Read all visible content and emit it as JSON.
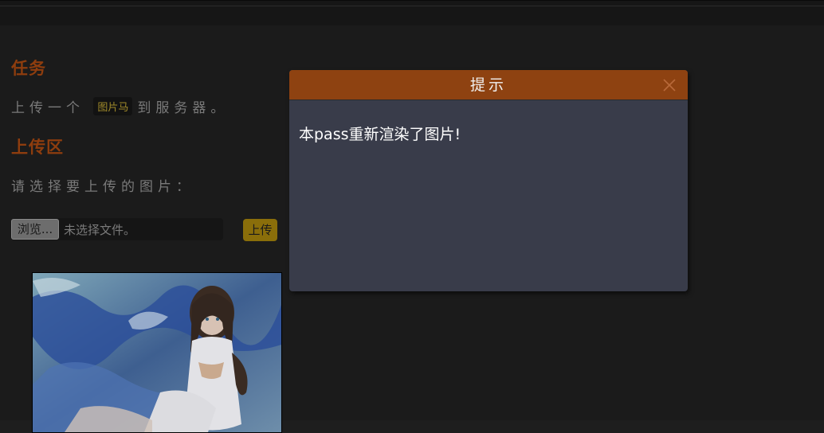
{
  "task": {
    "heading": "任务",
    "text_before": "上传一个",
    "tag": "图片马",
    "text_after": "到服务器。"
  },
  "upload": {
    "heading": "上传区",
    "prompt": "请选择要上传的图片：",
    "browse_label": "浏览...",
    "file_status": "未选择文件。",
    "submit_label": "上传"
  },
  "dialog": {
    "title": "提示",
    "message": "本pass重新渲染了图片!"
  },
  "colors": {
    "accent": "#8e4211",
    "heading": "#8e3d0e",
    "submit": "#8a6e0a",
    "dialog_bg": "#393c4a"
  }
}
